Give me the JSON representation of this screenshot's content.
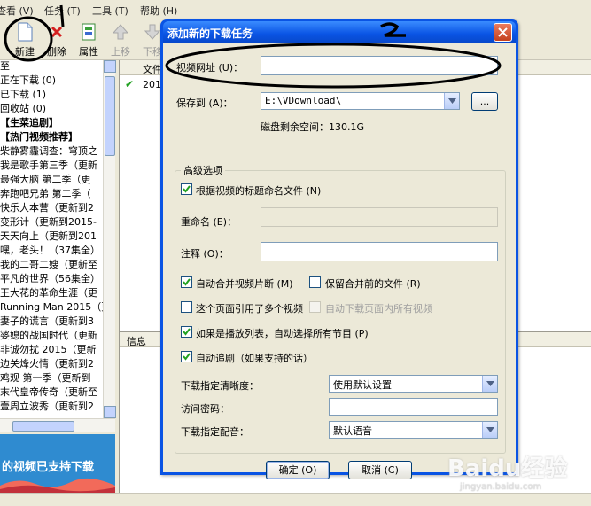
{
  "menubar": {
    "items": [
      "查看 (V)",
      "任务 (T)",
      "工具 (T)",
      "帮助 (H)"
    ]
  },
  "toolbar": {
    "new_label": "新建",
    "delete_label": "删除",
    "properties_label": "属性",
    "move_up_label": "上移",
    "move_down_label": "下移"
  },
  "sidebar": {
    "items": [
      {
        "label": "至",
        "bold": false
      },
      {
        "label": "正在下载 (0)",
        "bold": false
      },
      {
        "label": "已下载 (1)",
        "bold": false
      },
      {
        "label": "回收站 (0)",
        "bold": false
      },
      {
        "label": "【生菜追剧】",
        "bold": true
      },
      {
        "label": "【热门视频推荐】",
        "bold": true
      },
      {
        "label": "柴静雾霾调查：穹顶之",
        "bold": false
      },
      {
        "label": "我是歌手第三季（更新",
        "bold": false
      },
      {
        "label": "最强大脑 第二季（更",
        "bold": false
      },
      {
        "label": "奔跑吧兄弟 第二季（",
        "bold": false
      },
      {
        "label": "快乐大本营（更新到2",
        "bold": false
      },
      {
        "label": "变形计（更新到2015-",
        "bold": false
      },
      {
        "label": "天天向上（更新到201",
        "bold": false
      },
      {
        "label": "嘿，老头！（37集全）",
        "bold": false
      },
      {
        "label": "我的二哥二嫂（更新至",
        "bold": false
      },
      {
        "label": "平凡的世界（56集全）",
        "bold": false
      },
      {
        "label": "王大花的革命生涯（更",
        "bold": false
      },
      {
        "label": "Running Man 2015（更",
        "bold": false
      },
      {
        "label": "妻子的谎言（更新到3",
        "bold": false
      },
      {
        "label": "婆媳的战国时代（更新",
        "bold": false
      },
      {
        "label": "非诚勿扰 2015（更新",
        "bold": false
      },
      {
        "label": "边关烽火情（更新到2",
        "bold": false
      },
      {
        "label": "鸡观 第一季（更新到",
        "bold": false
      },
      {
        "label": "末代皇帝传奇（更新至",
        "bold": false
      },
      {
        "label": "壹周立波秀（更新到2",
        "bold": false
      }
    ]
  },
  "banner": {
    "text": "的视频已支持下载"
  },
  "list": {
    "column_file": "文件",
    "rows": [
      {
        "cell": "201"
      }
    ]
  },
  "info": {
    "header": "信息"
  },
  "dialog": {
    "title": "添加新的下载任务",
    "video_url_label": "视频网址 (U)：",
    "video_url_value": "",
    "save_to_label": "保存到 (A)：",
    "save_to_value": "E:\\VDownload\\",
    "browse_label": "...",
    "disk_space_text": "磁盘剩余空间：130.1G",
    "advanced_group_label": "高级选项",
    "name_by_title_label": "根据视频的标题命名文件 (N)",
    "name_by_title_checked": true,
    "rename_label": "重命名 (E)：",
    "rename_value": "",
    "note_label": "注释 (O)：",
    "note_value": "",
    "auto_merge_label": "自动合并视频片断 (M)",
    "auto_merge_checked": true,
    "keep_before_merge_label": "保留合并前的文件 (R)",
    "keep_before_merge_checked": false,
    "multi_video_label": "这个页面引用了多个视频",
    "multi_video_checked": false,
    "auto_download_all_label": "自动下载页面内所有视频",
    "auto_download_all_checked": false,
    "playlist_label": "如果是播放列表，自动选择所有节目 (P)",
    "playlist_checked": true,
    "auto_follow_label": "自动追剧（如果支持的话）",
    "auto_follow_checked": true,
    "resolution_label": "下载指定清晰度：",
    "resolution_value": "使用默认设置",
    "password_label": "访问密码：",
    "password_value": "",
    "dub_label": "下载指定配音：",
    "dub_value": "默认语音",
    "ok_label": "确定 (O)",
    "cancel_label": "取消 (C)"
  },
  "annotations": {
    "marker_1": "1",
    "marker_2": "2"
  },
  "watermark": {
    "brand": "Baidu经验",
    "url": "jingyan.baidu.com"
  },
  "colors": {
    "title_bar": "#0a54e4",
    "window_bg": "#ece9d8",
    "close_button": "#c4411e",
    "annotation_ink": "#000000"
  }
}
